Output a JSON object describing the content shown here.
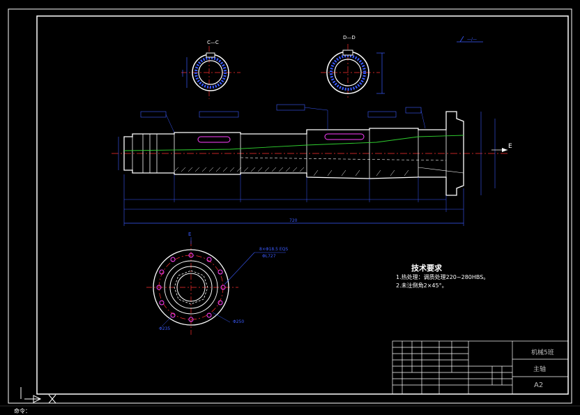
{
  "drawing": {
    "section_cc_label": "C—C",
    "section_dd_label": "D—D",
    "view_e_label": "E",
    "view_e_arrow_label": "E",
    "total_length_label": "720",
    "hole_note_line1": "8×Φ18.5 EQS",
    "hole_note_line2": "ΦL727",
    "diameter_label_1": "Φ235",
    "diameter_label_2": "Φ250"
  },
  "requirements": {
    "title": "技术要求",
    "line1": "1.热处理：调质处理220~280HBS。",
    "line2": "2.未注倒角2×45°。"
  },
  "title_block": {
    "school": "机械5班",
    "part_name": "主轴",
    "sheet_size": "A2"
  },
  "colors": {
    "background": "#000000",
    "linework": "#ffffff",
    "dimension": "#3b5bff",
    "center_line": "#ff3030",
    "hidden_green": "#30d030",
    "outline_magenta": "#ff40ff"
  },
  "icons": {
    "ucs_icon": "ucs-icon",
    "command_arrow": "arrow-icon"
  },
  "command_line": {
    "prompt": "命令："
  }
}
